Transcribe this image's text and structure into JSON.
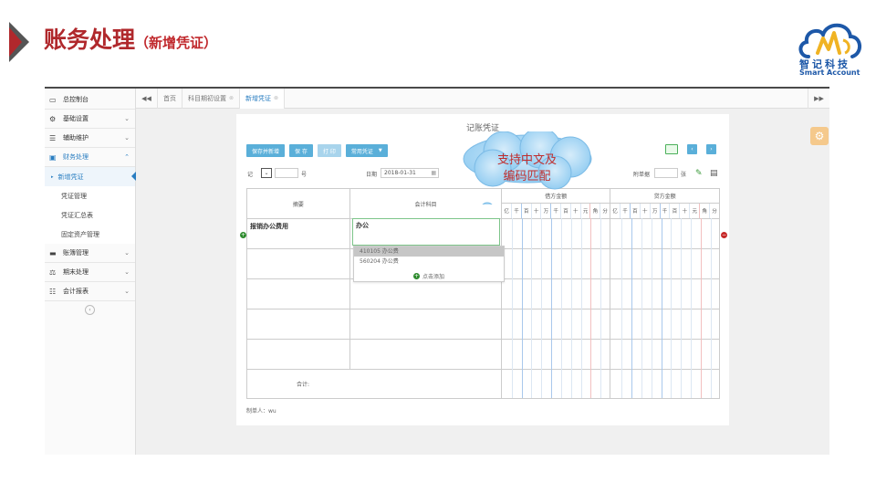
{
  "slide": {
    "title": "账务处理",
    "subtitle": "（新增凭证）"
  },
  "logo": {
    "cn": "智记科技",
    "en": "Smart  Account"
  },
  "colors": {
    "brand_red": "#b0282c",
    "accent_blue": "#2a7ec1",
    "button_blue": "#5aafd9",
    "logo_blue": "#1d58a8"
  },
  "sidebar": {
    "items": [
      {
        "label": "总控制台",
        "icon": "monitor-icon"
      },
      {
        "label": "基础设置",
        "icon": "cogs-icon"
      },
      {
        "label": "辅助维护",
        "icon": "list-icon"
      },
      {
        "label": "财务处理",
        "icon": "wallet-icon"
      },
      {
        "label": "账簿管理",
        "icon": "card-icon"
      },
      {
        "label": "期末处理",
        "icon": "scale-icon"
      },
      {
        "label": "会计报表",
        "icon": "report-icon"
      }
    ],
    "subitems": [
      "新增凭证",
      "凭证管理",
      "凭证汇总表",
      "固定资产管理"
    ]
  },
  "tabs": [
    {
      "label": "首页"
    },
    {
      "label": "科目期初设置"
    },
    {
      "label": "新增凭证"
    }
  ],
  "voucher": {
    "title": "记账凭证",
    "buttons": {
      "save_new": "保存并新增",
      "save": "保 存",
      "print": "打 印",
      "common": "常用凭证"
    },
    "type_value": "记",
    "number_unit": "号",
    "date_label": "日期",
    "date_value": "2018-01-31",
    "attachment_label": "附单据",
    "attachment_unit": "张",
    "col_summary": "摘要",
    "col_subject": "会计科目",
    "col_debit": "借方金额",
    "col_credit": "贷方金额",
    "digits": [
      "亿",
      "千",
      "百",
      "十",
      "万",
      "千",
      "百",
      "十",
      "元",
      "角",
      "分"
    ],
    "row1_summary": "报销办公费用",
    "subject_input": "办公",
    "total_label": "合计:",
    "maker_label": "制单人：",
    "maker_value": "wu"
  },
  "dropdown": {
    "options": [
      "410105 办公费",
      "560204 办公费"
    ],
    "add_label": "点击添加"
  },
  "callout": {
    "line1": "支持中文及",
    "line2": "编码匹配"
  }
}
